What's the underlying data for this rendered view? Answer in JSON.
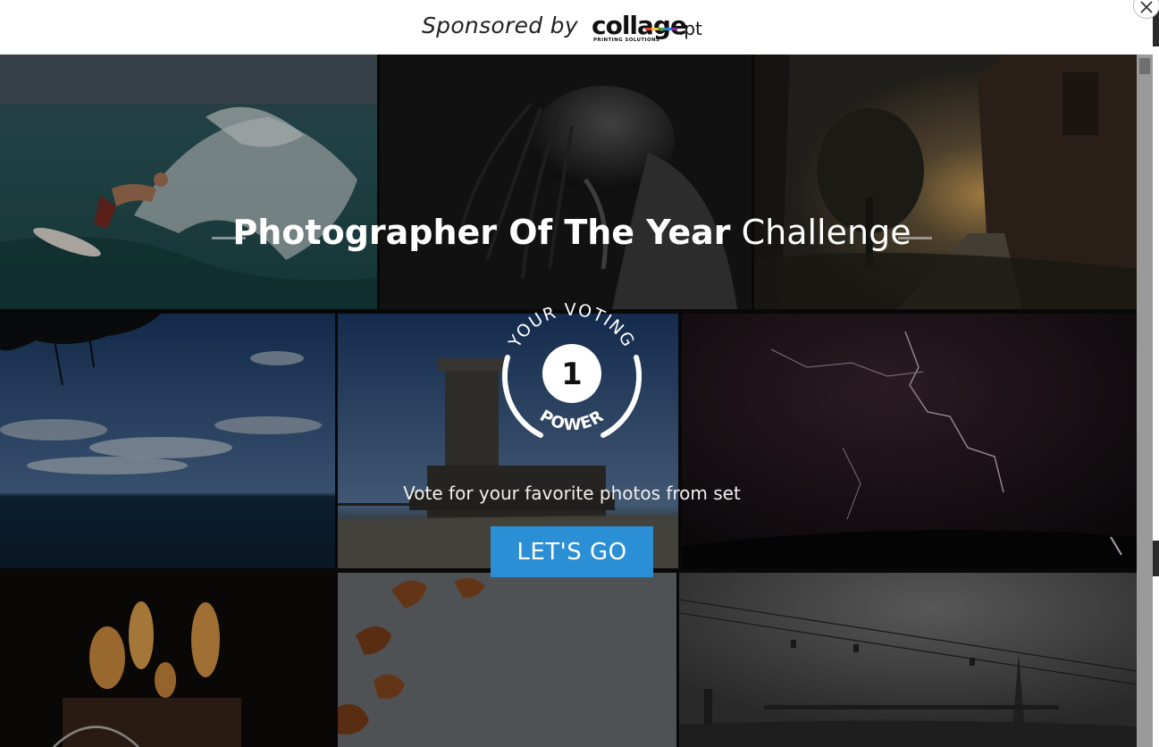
{
  "header": {
    "sponsored_label": "Sponsored by",
    "logo": {
      "wordmark": "collage",
      "tld": ".pt",
      "tagline": "PRINTING SOLUTIONS"
    }
  },
  "modal": {
    "title_bold": "Photographer Of The Year",
    "title_light": "Challenge",
    "badge": {
      "top_text": "YOUR VOTING",
      "number": "1",
      "bottom_text": "POWER"
    },
    "subtitle": "Vote for your favorite photos from set",
    "cta_label": "LET'S GO"
  },
  "photos": [
    {
      "name": "surfer-photo",
      "theme": "surfer riding a wave"
    },
    {
      "name": "portrait-photo",
      "theme": "black and white portrait with wet hair"
    },
    {
      "name": "church-sunset-photo",
      "theme": "church ruins at sunset"
    },
    {
      "name": "sea-clouds-photo",
      "theme": "sea under cloudy sky with pine branches"
    },
    {
      "name": "tower-photo",
      "theme": "tower on the water"
    },
    {
      "name": "lightning-photo",
      "theme": "lightning storm at night"
    },
    {
      "name": "candles-photo",
      "theme": "burning candles"
    },
    {
      "name": "autumn-leaves-photo",
      "theme": "orange leaves against grey sky"
    },
    {
      "name": "bridge-cablecar-photo",
      "theme": "bridge and cable cars in grey mist"
    }
  ],
  "colors": {
    "cta_background": "#2b8fd5",
    "header_background": "#ffffff"
  },
  "icons": {
    "close": "close-icon",
    "timer": "timer-icon"
  }
}
